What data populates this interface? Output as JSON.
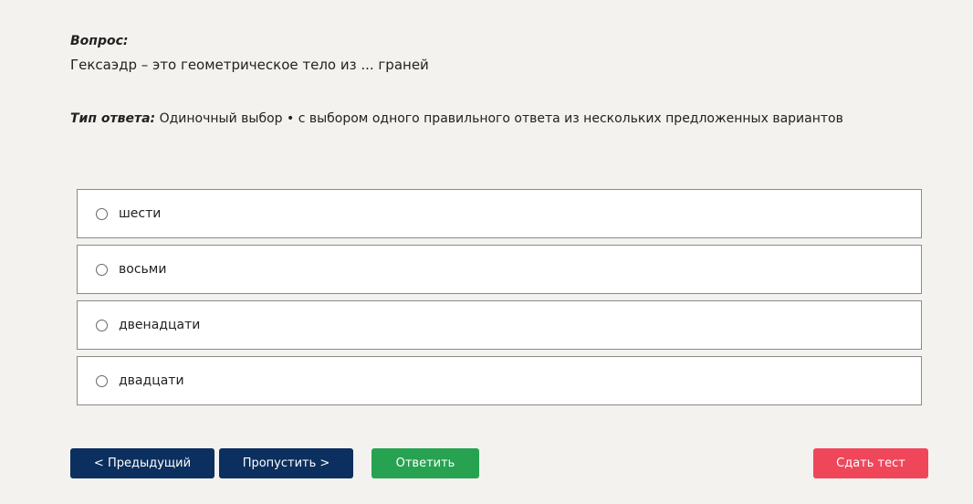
{
  "question": {
    "label": "Вопрос:",
    "text": "Гексаэдр – это геометрическое тело из ... граней"
  },
  "answer_type": {
    "label": "Тип ответа:",
    "value": "Одиночный выбор • с выбором одного правильного ответа из нескольких предложенных вариантов"
  },
  "options": [
    {
      "label": "шести"
    },
    {
      "label": "восьми"
    },
    {
      "label": "двенадцати"
    },
    {
      "label": "двадцати"
    }
  ],
  "buttons": {
    "previous": "< Предыдущий",
    "skip": "Пропустить >",
    "answer": "Ответить",
    "submit": "Сдать тест"
  },
  "colors": {
    "nav_button": "#0b2f5e",
    "answer_button": "#27a251",
    "submit_button": "#f0465a",
    "background": "#f3f2ef"
  }
}
